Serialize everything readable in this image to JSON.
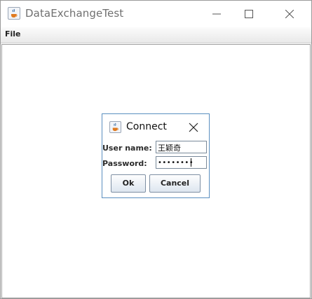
{
  "window": {
    "title": "DataExchangeTest",
    "app_icon": "java-cup-icon"
  },
  "window_controls": {
    "minimize_icon": "minimize-icon",
    "maximize_icon": "maximize-icon",
    "close_icon": "close-icon"
  },
  "menubar": {
    "items": [
      {
        "label": "File"
      }
    ]
  },
  "dialog": {
    "title": "Connect",
    "icon": "java-cup-icon",
    "close_icon": "close-icon",
    "fields": {
      "username_label": "User name:",
      "username_value": "王颖奇",
      "password_label": "Password:",
      "password_value": "••••••••"
    },
    "buttons": {
      "ok_label": "Ok",
      "cancel_label": "Cancel"
    }
  },
  "colors": {
    "dialog_border": "#5a8fc0",
    "button_top": "#fefefe",
    "button_bottom": "#dde6ef",
    "title_text": "#707070"
  }
}
